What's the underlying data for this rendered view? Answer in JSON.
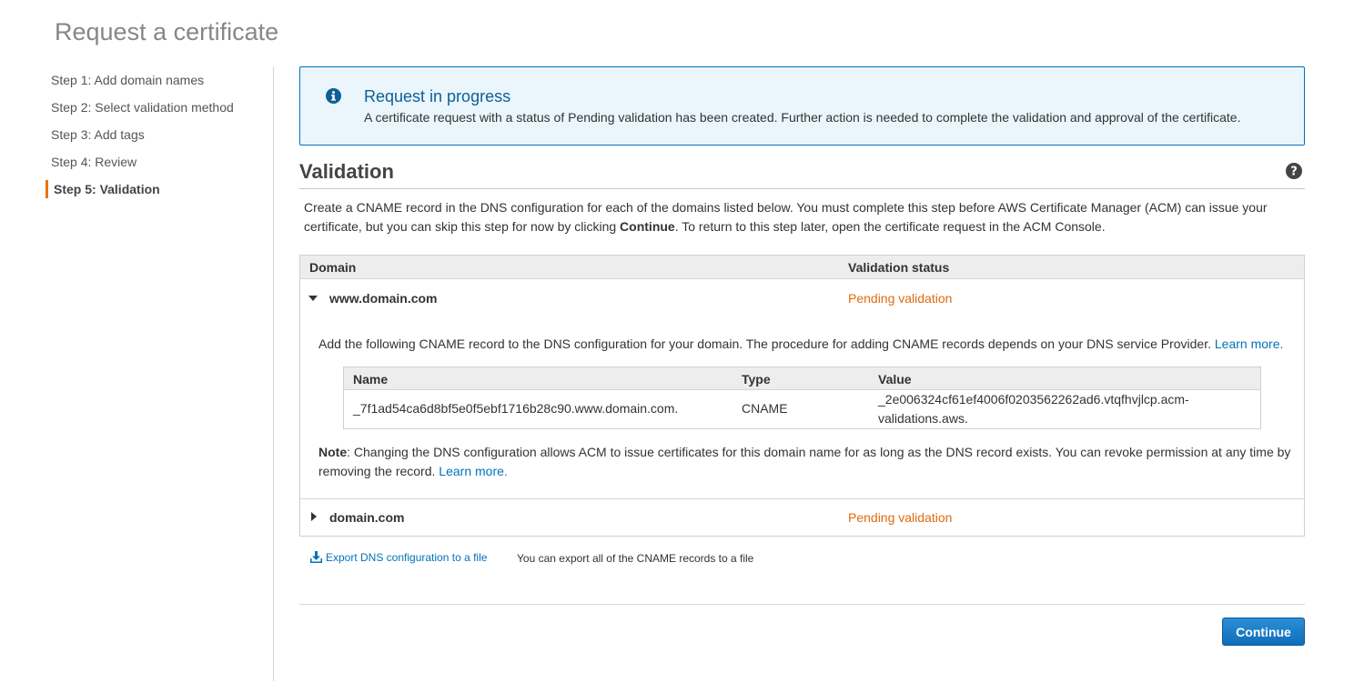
{
  "page": {
    "title": "Request a certificate"
  },
  "sidebar": {
    "steps": [
      {
        "label": "Step 1: Add domain names"
      },
      {
        "label": "Step 2: Select validation method"
      },
      {
        "label": "Step 3: Add tags"
      },
      {
        "label": "Step 4: Review"
      },
      {
        "label": "Step 5: Validation",
        "active": true
      }
    ]
  },
  "alert": {
    "icon": "info-icon",
    "title": "Request in progress",
    "body": "A certificate request with a status of Pending validation has been created. Further action is needed to complete the validation and approval of the certificate."
  },
  "validation": {
    "title": "Validation",
    "help_icon": "help-icon",
    "intro_part1": "Create a CNAME record in the DNS configuration for each of the domains listed below. You must complete this step before AWS Certificate Manager (ACM) can issue your certificate, but you can skip this step for now by clicking ",
    "intro_bold": "Continue",
    "intro_part2": ". To return to this step later, open the certificate request in the ACM Console."
  },
  "domains_table": {
    "columns": [
      "Domain",
      "Validation status"
    ],
    "rows": [
      {
        "domain": "www.domain.com",
        "status": "Pending validation",
        "expanded": true
      },
      {
        "domain": "domain.com",
        "status": "Pending validation",
        "expanded": false
      }
    ],
    "expanded_text": "Add the following CNAME record to the DNS configuration for your domain. The procedure for adding CNAME records depends on your DNS service Provider. ",
    "learn_more": "Learn more.",
    "cname_table": {
      "columns": [
        "Name",
        "Type",
        "Value"
      ],
      "row": {
        "name": "_7f1ad54ca6d8bf5e0f5ebf1716b28c90.www.domain.com.",
        "type": "CNAME",
        "value_line1": "_2e006324cf61ef4006f0203562262ad6.vtqfhvjlcp.acm-",
        "value_line2": "validations.aws."
      }
    },
    "note_label": "Note",
    "note_text": ": Changing the DNS configuration allows ACM to issue certificates for this domain name for as long as the DNS record exists. You can revoke permission at any time by removing the record. ",
    "note_link": "Learn more."
  },
  "export": {
    "icon": "download-icon",
    "link_label": "Export DNS configuration to a file",
    "description": "You can export all of the CNAME records to a file"
  },
  "actions": {
    "continue_label": "Continue"
  },
  "colors": {
    "accent": "#ec7211",
    "link": "#0073bb",
    "pending": "#dd6b10",
    "alert_bg": "#eaf6fc",
    "button": "#1a7dc7"
  }
}
